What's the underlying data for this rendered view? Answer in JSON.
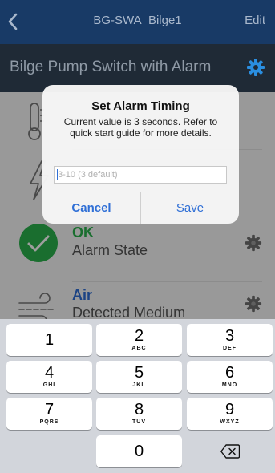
{
  "nav": {
    "title": "BG-SWA_Bilge1",
    "edit_label": "Edit"
  },
  "header": {
    "title": "Bilge Pump Switch with Alarm"
  },
  "rows": [
    {
      "status": "OK",
      "status_color": "#2bb24c",
      "label": "Alarm State",
      "icon": "check-circle-icon"
    },
    {
      "status": "Air",
      "status_color": "#2f6fd6",
      "label": "Detected Medium",
      "icon": "air-wave-icon"
    }
  ],
  "alert": {
    "title": "Set Alarm Timing",
    "message": "Current value is 3 seconds. Refer to quick start guide for more details.",
    "input_placeholder": "3-10 (3 default)",
    "cancel_label": "Cancel",
    "save_label": "Save"
  },
  "keyboard": {
    "keys": [
      {
        "num": "1",
        "letters": ""
      },
      {
        "num": "2",
        "letters": "ABC"
      },
      {
        "num": "3",
        "letters": "DEF"
      },
      {
        "num": "4",
        "letters": "GHI"
      },
      {
        "num": "5",
        "letters": "JKL"
      },
      {
        "num": "6",
        "letters": "MNO"
      },
      {
        "num": "7",
        "letters": "PQRS"
      },
      {
        "num": "8",
        "letters": "TUV"
      },
      {
        "num": "9",
        "letters": "WXYZ"
      },
      {
        "num": "0",
        "letters": ""
      }
    ]
  },
  "colors": {
    "navbar": "#183a66",
    "header": "#1f2a36",
    "accent": "#2f6fd6",
    "ok": "#2bb24c",
    "gear_blue": "#2a8ee0"
  }
}
